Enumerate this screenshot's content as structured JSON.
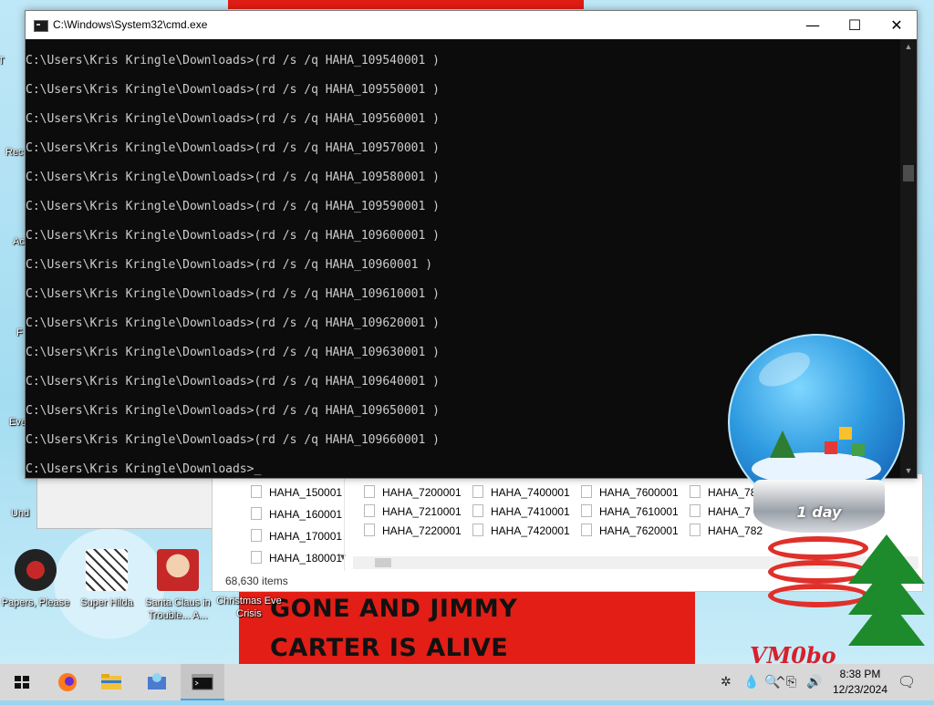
{
  "cmd": {
    "title": "C:\\Windows\\System32\\cmd.exe",
    "controls": {
      "minimize": "—",
      "maximize": "☐",
      "close": "✕"
    },
    "lines": [
      "C:\\Users\\Kris Kringle\\Downloads>(rd /s /q HAHA_109540001 )",
      "C:\\Users\\Kris Kringle\\Downloads>(rd /s /q HAHA_109550001 )",
      "C:\\Users\\Kris Kringle\\Downloads>(rd /s /q HAHA_109560001 )",
      "C:\\Users\\Kris Kringle\\Downloads>(rd /s /q HAHA_109570001 )",
      "C:\\Users\\Kris Kringle\\Downloads>(rd /s /q HAHA_109580001 )",
      "C:\\Users\\Kris Kringle\\Downloads>(rd /s /q HAHA_109590001 )",
      "C:\\Users\\Kris Kringle\\Downloads>(rd /s /q HAHA_109600001 )",
      "C:\\Users\\Kris Kringle\\Downloads>(rd /s /q HAHA_10960001 )",
      "C:\\Users\\Kris Kringle\\Downloads>(rd /s /q HAHA_109610001 )",
      "C:\\Users\\Kris Kringle\\Downloads>(rd /s /q HAHA_109620001 )",
      "C:\\Users\\Kris Kringle\\Downloads>(rd /s /q HAHA_109630001 )",
      "C:\\Users\\Kris Kringle\\Downloads>(rd /s /q HAHA_109640001 )",
      "C:\\Users\\Kris Kringle\\Downloads>(rd /s /q HAHA_109650001 )",
      "C:\\Users\\Kris Kringle\\Downloads>(rd /s /q HAHA_109660001 )",
      "C:\\Users\\Kris Kringle\\Downloads>_"
    ]
  },
  "explorer": {
    "left_files": [
      "HAHA_150001",
      "HAHA_160001",
      "HAHA_170001",
      "HAHA_180001"
    ],
    "grid_files": [
      [
        "HAHA_7200001",
        "HAHA_7400001",
        "HAHA_7600001",
        "HAHA_78"
      ],
      [
        "HAHA_7210001",
        "HAHA_7410001",
        "HAHA_7610001",
        "HAHA_7"
      ],
      [
        "HAHA_7220001",
        "HAHA_7420001",
        "HAHA_7620001",
        "HAHA_782"
      ]
    ],
    "status": "68,630 items"
  },
  "desktop_icons": [
    {
      "label": "Papers, Please"
    },
    {
      "label": "Super Hilda"
    },
    {
      "label": "Santa Claus in Trouble... A..."
    },
    {
      "label": "Christmas Eve Crisis"
    }
  ],
  "left_edge_labels": [
    "T",
    "Rec",
    "Ac",
    "F",
    "Eve",
    "Und"
  ],
  "wallpaper_text": {
    "line1": "GONE AND JIMMY",
    "line2": "CARTER IS ALIVE",
    "corner": "VM0bo"
  },
  "snow_globe": {
    "label": "1 day"
  },
  "taskbar": {
    "apps": [
      "start",
      "firefox",
      "file-explorer",
      "app",
      "cmd"
    ],
    "time": "8:38 PM",
    "date": "12/23/2024"
  },
  "colors": {
    "console_bg": "#0c0c0c",
    "console_fg": "#cccccc",
    "taskbar": "#d8d8d8",
    "accent": "#4aa3df"
  }
}
